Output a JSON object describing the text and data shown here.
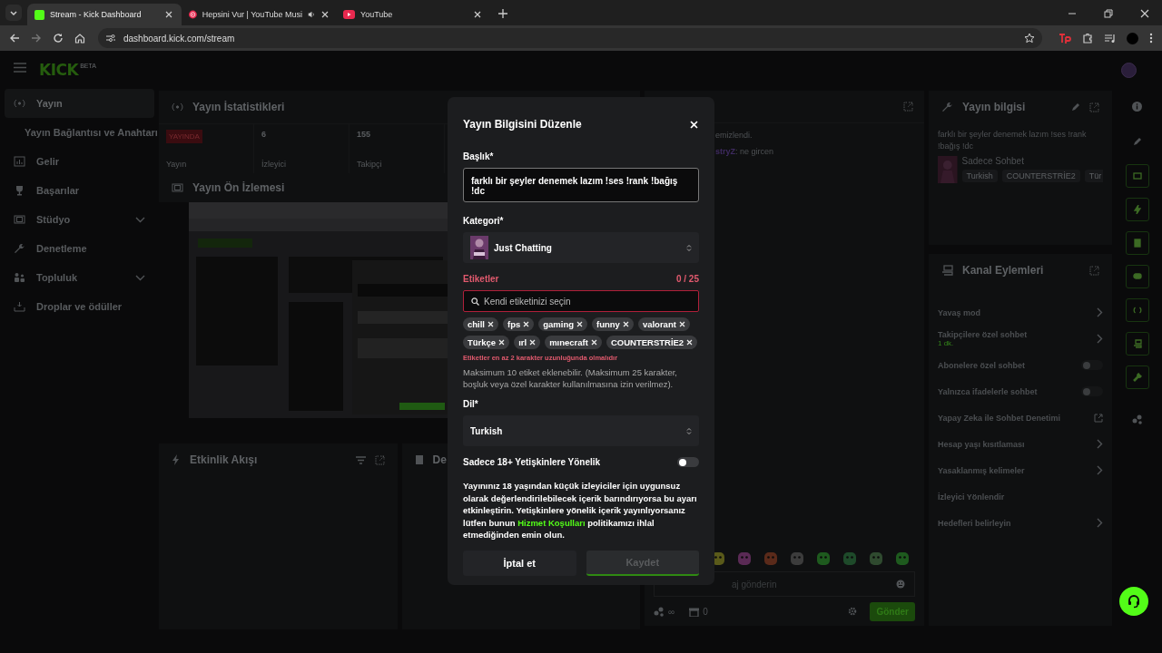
{
  "browser": {
    "tabs": [
      {
        "title": "Stream - Kick Dashboard",
        "selected": true,
        "audio": false
      },
      {
        "title": "Hepsini Vur | YouTube Musi",
        "selected": false,
        "audio": true
      },
      {
        "title": "YouTube",
        "selected": false,
        "audio": false
      }
    ],
    "url": "dashboard.kick.com/stream"
  },
  "header": {
    "logo": "KICK",
    "badge": "BETA"
  },
  "sidebar": {
    "items": [
      {
        "label": "Yayın",
        "selected": true,
        "expandable": false,
        "children": [
          {
            "label": "Yayın Bağlantısı ve Anahtarı",
            "selected": false
          }
        ]
      },
      {
        "label": "Gelir",
        "selected": false,
        "expandable": false
      },
      {
        "label": "Başarılar",
        "selected": false,
        "expandable": false
      },
      {
        "label": "Stüdyo",
        "selected": false,
        "expandable": true
      },
      {
        "label": "Denetleme",
        "selected": false,
        "expandable": false
      },
      {
        "label": "Topluluk",
        "selected": false,
        "expandable": true
      },
      {
        "label": "Droplar ve ödüller",
        "selected": false,
        "expandable": false
      }
    ]
  },
  "stats": {
    "title": "Yayın İstatistikleri",
    "status_badge": "YAYINDA",
    "status_label": "Yayın",
    "metrics": [
      {
        "value": "6",
        "label": "İzleyici"
      },
      {
        "value": "155",
        "label": "Takipçi"
      }
    ]
  },
  "preview": {
    "title": "Yayın Ön İzlemesi"
  },
  "activity": {
    "title": "Etkinlik Akışı"
  },
  "panel_4": {
    "title": "De"
  },
  "chat": {
    "messages": [
      {
        "text": "emizlendi."
      },
      {
        "user": "stryZ",
        "text": ": ne gircen"
      }
    ],
    "placeholder": "aj gönderin",
    "emote_count": "∞",
    "gift_count": "0",
    "send": "Gönder"
  },
  "stream_info": {
    "title": "Yayın bilgisi",
    "stream_title": "farklı bir şeyler denemek lazım !ses !rank !bağış !dc",
    "category": "Sadece Sohbet",
    "tags": [
      "Turkish",
      "COUNTERSTRİE2",
      "Tür"
    ]
  },
  "channel_actions": {
    "title": "Kanal Eylemleri",
    "items": [
      {
        "label": "Yavaş mod",
        "kind": "chevron"
      },
      {
        "label": "Takipçilere özel sohbet",
        "kind": "chevron",
        "detail": "1 dk."
      },
      {
        "label": "Abonelere özel sohbet",
        "kind": "toggle",
        "on": false
      },
      {
        "label": "Yalnızca ifadelerle sohbet",
        "kind": "toggle",
        "on": false
      },
      {
        "label": "Yapay Zeka ile Sohbet Denetimi",
        "kind": "external"
      },
      {
        "label": "Hesap yaşı kısıtlaması",
        "kind": "chevron"
      },
      {
        "label": "Yasaklanmış kelimeler",
        "kind": "chevron"
      },
      {
        "label": "İzleyici Yönlendir",
        "kind": "plain"
      },
      {
        "label": "Hedefleri belirleyin",
        "kind": "chevron"
      }
    ]
  },
  "modal": {
    "title": "Yayın Bilgisini Düzenle",
    "title_label": "Başlık*",
    "title_value": "farklı bir şeyler denemek lazım !ses !rank !bağış !dc",
    "category_label": "Kategori*",
    "category": "Just Chatting",
    "tags_label": "Etiketler",
    "tags_count": "0 / 25",
    "tags_invalid": true,
    "tags_placeholder": "Kendi etiketinizi seçin",
    "tags": [
      "chill",
      "fps",
      "gaming",
      "funny",
      "valorant",
      "Türkçe",
      "ırl",
      "mınecraft",
      "COUNTERSTRİE2"
    ],
    "tags_error": "Etiketler en az 2 karakter uzunluğunda olmalıdır",
    "tags_help": "Maksimum 10 etiket eklenebilir. (Maksimum 25 karakter, boşluk veya özel karakter kullanılmasına izin verilmez).",
    "language_label": "Dil*",
    "language": "Turkish",
    "mature_label": "Sadece 18+ Yetişkinlere Yönelik",
    "mature_on": false,
    "warning": {
      "before": "Yayınınız 18 yaşından küçük izleyiciler için uygunsuz olarak değerlendirilebilecek içerik barındırıyorsa bu ayarı etkinleştirin. Yetişkinlere yönelik içerik yayınlıyorsanız lütfen bunun",
      "link": "Hizmet Koşulları",
      "after": "politikamızı ihlal etmediğinden emin olun."
    },
    "cancel": "İptal et",
    "save": "Kaydet",
    "save_disabled": true
  }
}
